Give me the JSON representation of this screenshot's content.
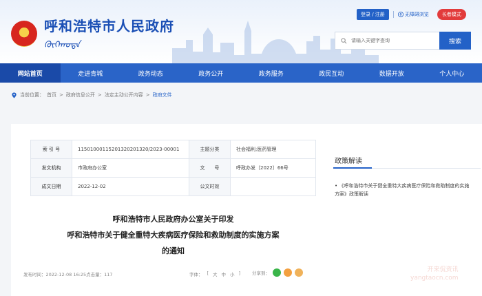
{
  "header": {
    "site_title": "呼和浩特市人民政府",
    "login_label": "登录 / 注册",
    "accessibility_label": "无障碍浏览",
    "elder_mode_label": "长者模式",
    "search_placeholder": "请输入关键字查询",
    "search_button": "搜索"
  },
  "nav": {
    "items": [
      "网站首页",
      "走进青城",
      "政务动态",
      "政务公开",
      "政务服务",
      "政民互动",
      "数据开放",
      "个人中心"
    ]
  },
  "breadcrumb": {
    "prefix": "当前位置：",
    "items": [
      "首页",
      "政府信息公开",
      "法定主动公开内容",
      "政府文件"
    ],
    "separator": ">"
  },
  "info": {
    "index_label": "索 引 号",
    "index_value": "11501000115201320201320/2023-00001",
    "category_label": "主题分类",
    "category_value": "社会福利;医药管理",
    "issuer_label": "发文机构",
    "issuer_value": "市政府办公室",
    "docno_label": "文　　号",
    "docno_value": "呼政办发〔2022〕66号",
    "date_label": "成文日期",
    "date_value": "2022-12-02",
    "publish_label": "公文时效",
    "publish_value": ""
  },
  "document": {
    "title_line1": "呼和浩特市人民政府办公室关于印发",
    "title_line2": "呼和浩特市关于健全重特大疾病医疗保险和救助制度的实施方案",
    "title_line3": "的通知",
    "meta": "发布时间：2022-12-08 16:25点击量：117",
    "font_label": "字体：",
    "font_sizes": [
      "[",
      "大",
      "中",
      "小",
      "]"
    ],
    "share_label": "分享到："
  },
  "side": {
    "title": "政策解读",
    "item": "《呼和浩特市关于健全重特大疾病医疗保险和救助制度的实施方案》政策解读"
  },
  "colors": {
    "primary": "#2361c7",
    "nav_bg": "#2a64c8",
    "nav_active": "#1a4aa8",
    "elder_btn": "#e23b3b"
  }
}
